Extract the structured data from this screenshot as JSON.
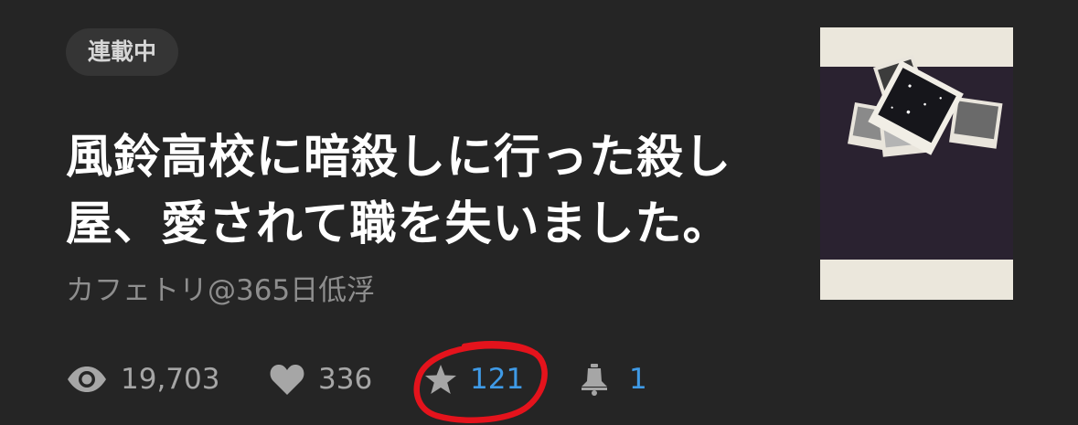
{
  "series": {
    "status_badge": "連載中",
    "title": "風鈴高校に暗殺しに行った殺し屋、愛されて職を失いました。",
    "author": "カフェトリ@365日低浮"
  },
  "stats": {
    "views": "19,703",
    "likes": "336",
    "bookmarks": "121",
    "reactions": "1"
  },
  "icons": {
    "views": "eye-icon",
    "likes": "heart-icon",
    "bookmarks": "star-icon",
    "reactions": "bell-icon"
  },
  "colors": {
    "background": "#252525",
    "accent_blue": "#3f9ae6",
    "highlight_red": "#e4131c"
  }
}
